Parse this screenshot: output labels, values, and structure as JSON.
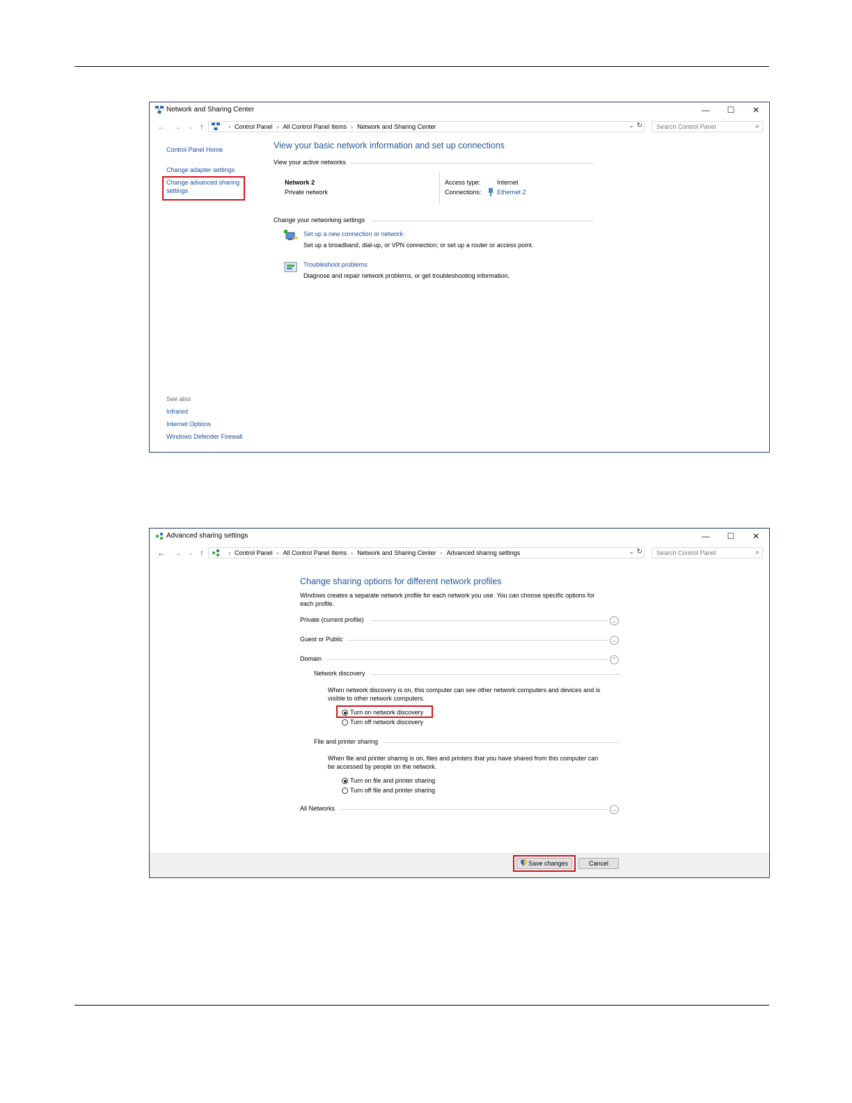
{
  "win1": {
    "title": "Network and Sharing Center",
    "controls": {
      "minimize": "—",
      "maximize": "☐",
      "close": "✕"
    },
    "nav": {
      "back": "←",
      "forward": "→",
      "recent": "⌄",
      "up": "↑"
    },
    "breadcrumbs": [
      "Control Panel",
      "All Control Panel Items",
      "Network and Sharing Center"
    ],
    "breadcrumb_sep": "›",
    "address_dropdown": "⌄",
    "refresh": "↻",
    "search_placeholder": "Search Control Panel",
    "search_icon": "⌕",
    "sidebar": {
      "home": "Control Panel Home",
      "adapter": "Change adapter settings",
      "advanced_line1": "Change advanced sharing",
      "advanced_line2": "settings",
      "see_also": "See also",
      "infrared": "Infrared",
      "internet_options": "Internet Options",
      "firewall": "Windows Defender Firewall"
    },
    "main": {
      "heading": "View your basic network information and set up connections",
      "active_networks": "View your active networks",
      "network_name": "Network 2",
      "network_type": "Private network",
      "access_type_label": "Access type:",
      "access_type_value": "Internet",
      "connections_label": "Connections:",
      "connections_value": "Ethernet 2",
      "change_settings": "Change your networking settings",
      "setup_link": "Set up a new connection or network",
      "setup_desc": "Set up a broadband, dial-up, or VPN connection; or set up a router or access point.",
      "troubleshoot_link": "Troubleshoot problems",
      "troubleshoot_desc": "Diagnose and repair network problems, or get troubleshooting information."
    }
  },
  "win2": {
    "title": "Advanced sharing settings",
    "controls": {
      "minimize": "—",
      "maximize": "☐",
      "close": "✕"
    },
    "nav": {
      "back": "←",
      "forward": "→",
      "recent": "⌄",
      "up": "↑"
    },
    "breadcrumbs": [
      "Control Panel",
      "All Control Panel Items",
      "Network and Sharing Center",
      "Advanced sharing settings"
    ],
    "breadcrumb_sep": "›",
    "address_dropdown": "⌄",
    "refresh": "↻",
    "search_placeholder": "Search Control Panel",
    "search_icon": "⌕",
    "heading": "Change sharing options for different network profiles",
    "intro_line1": "Windows creates a separate network profile for each network you use. You can choose specific options for",
    "intro_line2": "each profile.",
    "profiles": {
      "private": "Private (current profile)",
      "guest": "Guest or Public",
      "domain": "Domain",
      "all": "All Networks"
    },
    "chevron_down": "⌄",
    "chevron_up": "⌃",
    "discovery": {
      "heading": "Network discovery",
      "desc_line1": "When network discovery is on, this computer can see other network computers and devices and is",
      "desc_line2": "visible to other network computers.",
      "on": "Turn on network discovery",
      "off": "Turn off network discovery",
      "selected": "on"
    },
    "file_sharing": {
      "heading": "File and printer sharing",
      "desc_line1": "When file and printer sharing is on, files and printers that you have shared from this computer can",
      "desc_line2": "be accessed by people on the network.",
      "on": "Turn on file and printer sharing",
      "off": "Turn off file and printer sharing",
      "selected": "on"
    },
    "save_button": "Save changes",
    "cancel_button": "Cancel"
  },
  "colors": {
    "link": "#1a4fa0",
    "heading": "#1e5799",
    "highlight": "#d0141e",
    "window_border": "#1a3a6e"
  }
}
